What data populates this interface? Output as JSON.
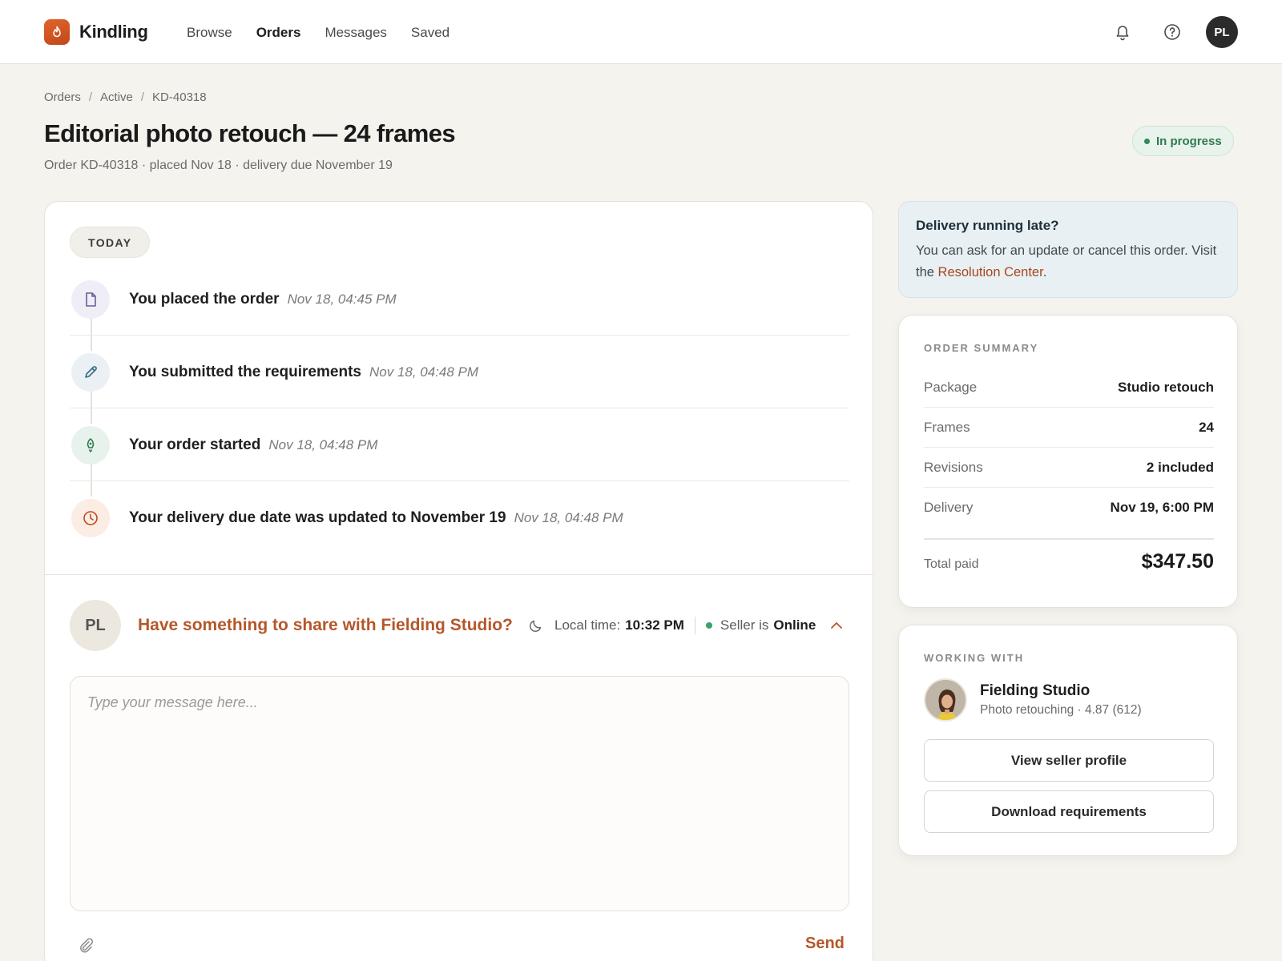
{
  "app": {
    "brand": "Kindling",
    "nav": [
      {
        "label": "Browse",
        "active": false
      },
      {
        "label": "Orders",
        "active": true
      },
      {
        "label": "Messages",
        "active": false
      },
      {
        "label": "Saved",
        "active": false
      }
    ],
    "user_initials": "PL",
    "accent_color": "#c8521f"
  },
  "breadcrumb": [
    "Orders",
    "Active",
    "KD-40318"
  ],
  "header": {
    "title": "Editorial photo retouch — 24 frames",
    "subtitle": "Order KD-40318 · placed Nov 18 · delivery due November 19",
    "status": "In progress"
  },
  "timeline": {
    "group_label": "TODAY",
    "events": [
      {
        "title": "You placed the order",
        "time": "Nov 18, 04:45 PM",
        "icon": "document-icon"
      },
      {
        "title": "You submitted the requirements",
        "time": "Nov 18, 04:48 PM",
        "icon": "pencil-icon"
      },
      {
        "title": "Your order started",
        "time": "Nov 18, 04:48 PM",
        "icon": "rocket-icon"
      },
      {
        "title": "Your delivery due date was updated to November 19",
        "time": "Nov 18, 04:48 PM",
        "icon": "clock-icon"
      }
    ]
  },
  "composer": {
    "avatar_initials": "PL",
    "prompt": "Have something to share with Fielding Studio?",
    "local_time_label": "Local time:",
    "local_time": "10:32 PM",
    "seller_status_label": "Seller is",
    "seller_status": "Online",
    "placeholder": "Type your message here...",
    "send_label": "Send"
  },
  "late_notice": {
    "title": "Delivery running late?",
    "body": "You can ask for an update or cancel this order. Visit the",
    "link": "Resolution Center",
    "suffix": "."
  },
  "order_summary": {
    "label": "ORDER SUMMARY",
    "rows": [
      {
        "key": "Package",
        "value": "Studio retouch"
      },
      {
        "key": "Frames",
        "value": "24"
      },
      {
        "key": "Revisions",
        "value": "2 included"
      },
      {
        "key": "Delivery",
        "value": "Nov 19, 6:00 PM"
      }
    ],
    "total_label": "Total paid",
    "total_value": "$347.50"
  },
  "seller": {
    "label": "WORKING WITH",
    "name": "Fielding Studio",
    "meta": "Photo retouching · 4.87 (612)",
    "view_profile_label": "View seller profile",
    "download_label": "Download requirements"
  }
}
